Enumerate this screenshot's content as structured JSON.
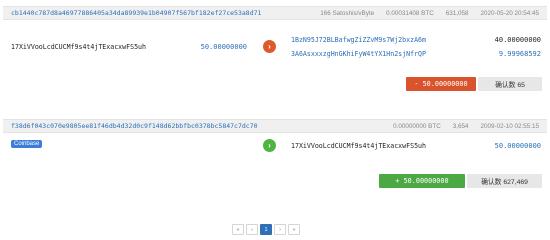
{
  "transactions": [
    {
      "hash": "cb1440c787d8a46977886405a34da89939e1b04907f567bf182ef27ce53a8d71",
      "fee_rate": "166 Satoshis/vByte",
      "fee": "0.00031408 BTC",
      "size": "631,058",
      "time": "2020-05-20 20:54:45",
      "inputs": [
        {
          "address": "17XiVVooLcdCUCMf9s4t4jTExacxwFS5uh",
          "amount": "50.00000000"
        }
      ],
      "arrow": "›",
      "outputs": [
        {
          "address": "1BzN95J72BLBafwgZiZZvM9s7Wj2bxzA6m",
          "amount": "40.00000000"
        },
        {
          "address": "3A6AsxxxzgHnGKhiFyW4tYX1Hn2sjNfrQP",
          "amount": "9.99968592"
        }
      ],
      "total": "- 50.00000000",
      "confirmations": "确认数 65"
    },
    {
      "hash": "f38d6f043c070e9805ee81f46db4d32d0c9f148d62bbfbc0378bc5847c7dc70",
      "fee_rate": "",
      "fee": "0.00000000 BTC",
      "size": "3,654",
      "time": "2009-02-10 02:55:15",
      "coinbase_label": "Coinbase",
      "arrow": "›",
      "outputs": [
        {
          "address": "17XiVVooLcdCUCMf9s4t4jTExacxwFS5uh",
          "amount": "50.00000000"
        }
      ],
      "total": "+ 50.00000000",
      "confirmations": "确认数 627,469"
    }
  ],
  "pagination": {
    "first": "«",
    "prev": "‹",
    "current": "1",
    "next": "›",
    "last": "»"
  },
  "colors": {
    "link": "#2a6fb8",
    "negative": "#d9542c",
    "positive": "#4ca842",
    "active_page": "#2f6fb7"
  }
}
